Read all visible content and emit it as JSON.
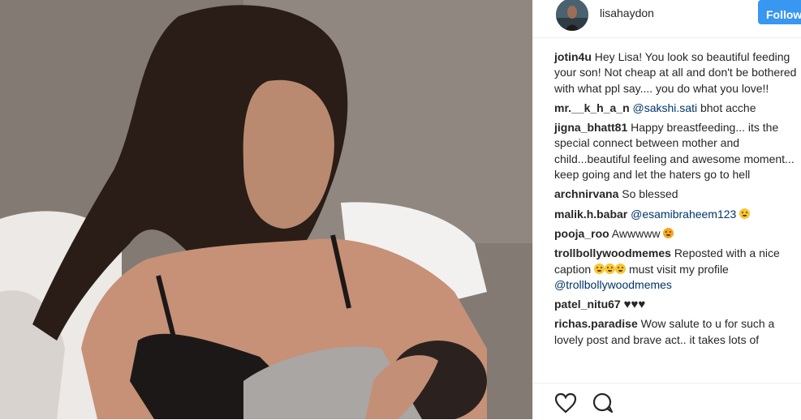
{
  "post": {
    "username": "lisahaydon",
    "follow_label": "Follow"
  },
  "comments": [
    {
      "user": "jotin4u",
      "text": "Hey Lisa! You look so beautiful feeding your son! Not cheap at all and don't be bothered with what ppl say.... you do what you love!!"
    },
    {
      "user": "mr.__k_h_a_n",
      "mention": "@sakshi.sati",
      "text": "bhot acche"
    },
    {
      "user": "jigna_bhatt81",
      "text": "Happy breastfeeding... its the special connect between mother and child...beautiful feeling and awesome moment... keep going and let the haters go to hell"
    },
    {
      "user": "archnirvana",
      "text": "So blessed"
    },
    {
      "user": "malik.h.babar",
      "mention": "@esamibraheem123",
      "emoji": "smile"
    },
    {
      "user": "pooja_roo",
      "text": "Awwwww",
      "emoji": "wow"
    },
    {
      "user": "trollbollywoodmemes",
      "text_before": "Reposted with a nice caption",
      "text_after": "must visit my profile",
      "mention": "@trollbollywoodmemes"
    },
    {
      "user": "patel_nitu67",
      "text": "♥♥♥"
    },
    {
      "user": "richas.paradise",
      "text": "Wow salute to u for such a lovely post and brave act.. it takes lots of"
    }
  ],
  "icons": {
    "like": "heart-icon",
    "comment": "comment-icon"
  }
}
